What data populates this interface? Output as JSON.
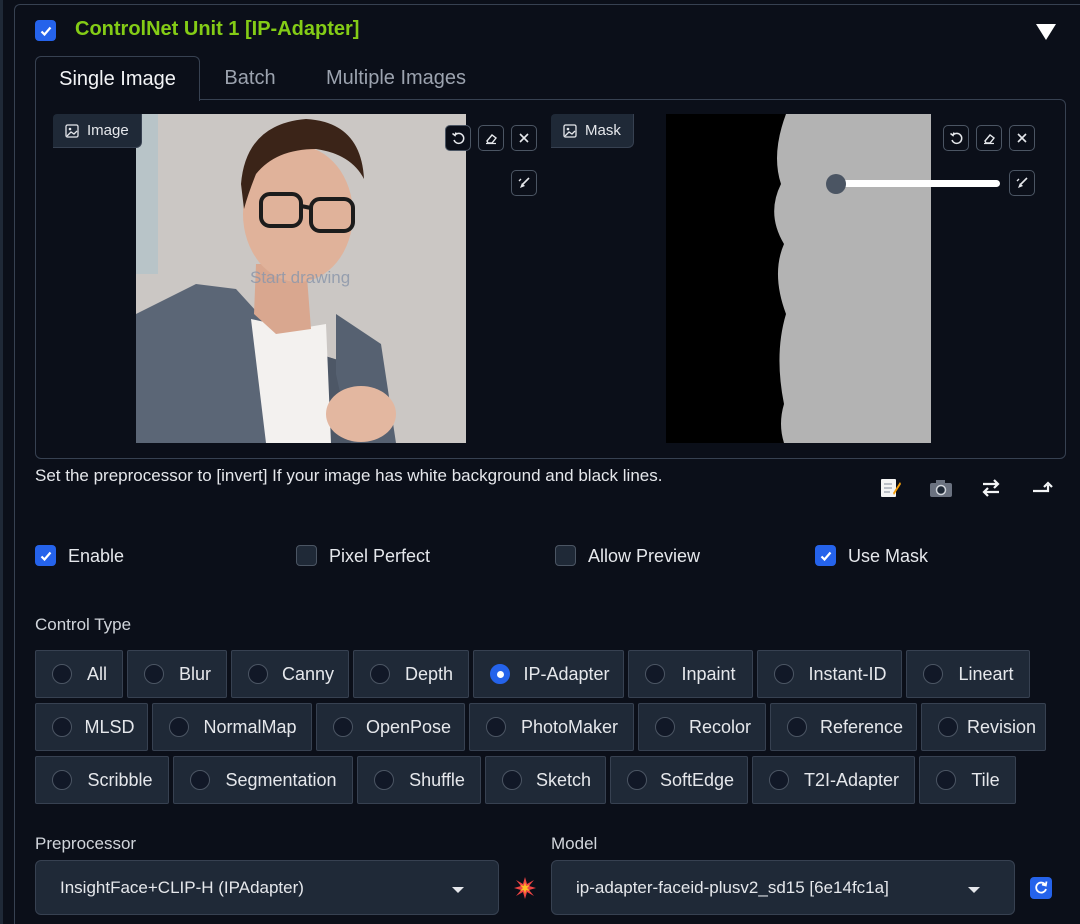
{
  "header": {
    "title": "ControlNet Unit 1 [IP-Adapter]",
    "enabled": true
  },
  "tabs": [
    {
      "label": "Single Image",
      "active": true
    },
    {
      "label": "Batch",
      "active": false
    },
    {
      "label": "Multiple Images",
      "active": false
    }
  ],
  "image_panel": {
    "label": "Image",
    "overlay_text": "Start drawing",
    "icons": [
      "undo-icon",
      "eraser-icon",
      "close-icon",
      "brush-icon"
    ]
  },
  "mask_panel": {
    "label": "Mask",
    "brush_size": 0.0,
    "icons": [
      "undo-icon",
      "eraser-icon",
      "close-icon",
      "brush-icon"
    ]
  },
  "hint": "Set the preprocessor to [invert] If your image has white background and black lines.",
  "action_icons": [
    "notepad-icon",
    "camera-icon",
    "swap-icon",
    "send-dimensions-icon"
  ],
  "options": [
    {
      "label": "Enable",
      "checked": true
    },
    {
      "label": "Pixel Perfect",
      "checked": false
    },
    {
      "label": "Allow Preview",
      "checked": false
    },
    {
      "label": "Use Mask",
      "checked": true
    }
  ],
  "control_type": {
    "label": "Control Type",
    "selected": "IP-Adapter",
    "rows": [
      [
        "All",
        "Blur",
        "Canny",
        "Depth",
        "IP-Adapter",
        "Inpaint",
        "Instant-ID",
        "Lineart"
      ],
      [
        "MLSD",
        "NormalMap",
        "OpenPose",
        "PhotoMaker",
        "Recolor",
        "Reference",
        "Revision"
      ],
      [
        "Scribble",
        "Segmentation",
        "Shuffle",
        "Sketch",
        "SoftEdge",
        "T2I-Adapter",
        "Tile"
      ]
    ]
  },
  "preprocessor": {
    "label": "Preprocessor",
    "value": "InsightFace+CLIP-H (IPAdapter)"
  },
  "model": {
    "label": "Model",
    "value": "ip-adapter-faceid-plusv2_sd15 [6e14fc1a]"
  },
  "colors": {
    "accent": "#2563eb",
    "title": "#84cc16",
    "background": "#0b0f19",
    "button": "#1f2937"
  }
}
